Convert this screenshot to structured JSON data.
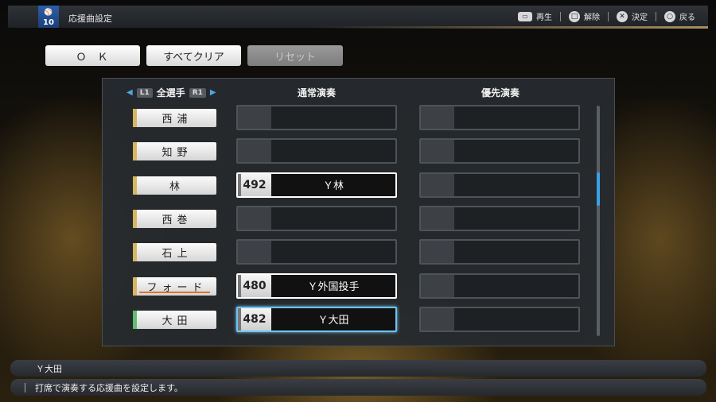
{
  "header": {
    "team_number": "10",
    "team_mark": "⚾",
    "title": "応援曲設定",
    "hints": [
      {
        "icon": "touchpad-icon",
        "label": "再生"
      },
      {
        "icon": "square-button-icon",
        "glyph": "□",
        "label": "解除"
      },
      {
        "icon": "cross-button-icon",
        "glyph": "✕",
        "label": "決定"
      },
      {
        "icon": "circle-button-icon",
        "glyph": "○",
        "label": "戻る"
      }
    ]
  },
  "actions": {
    "ok": "ＯＫ",
    "clear_all": "すべてクリア",
    "reset": "リセット"
  },
  "table": {
    "left_tag": "L1",
    "right_tag": "R1",
    "players_header": "全選手",
    "normal_header": "通常演奏",
    "priority_header": "優先演奏",
    "rows": [
      {
        "player": "西浦",
        "normal_num": "",
        "normal_name": "",
        "priority_num": "",
        "priority_name": ""
      },
      {
        "player": "知野",
        "normal_num": "",
        "normal_name": "",
        "priority_num": "",
        "priority_name": ""
      },
      {
        "player": "林",
        "normal_num": "492",
        "normal_name": "Ｙ林",
        "priority_num": "",
        "priority_name": ""
      },
      {
        "player": "西巻",
        "normal_num": "",
        "normal_name": "",
        "priority_num": "",
        "priority_name": ""
      },
      {
        "player": "石上",
        "normal_num": "",
        "normal_name": "",
        "priority_num": "",
        "priority_name": ""
      },
      {
        "player": "フォード",
        "normal_num": "480",
        "normal_name": "Ｙ外国投手",
        "priority_num": "",
        "priority_name": ""
      },
      {
        "player": "大田",
        "normal_num": "482",
        "normal_name": "Ｙ大田",
        "priority_num": "",
        "priority_name": ""
      }
    ],
    "selected_row": 6
  },
  "status": {
    "song_info": "Ｙ大田",
    "help": "打席で演奏する応援曲を設定します。"
  },
  "colors": {
    "accent_blue": "#3aa0e8",
    "player_marker_gold": "#d8b560",
    "player_marker_green": "#5fbf6e",
    "underline_orange": "#e0742a"
  }
}
